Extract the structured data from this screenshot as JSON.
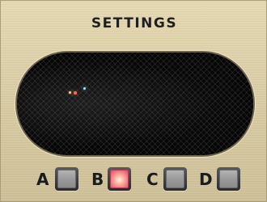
{
  "panel": {
    "title": "SETTINGS"
  },
  "buttons": [
    {
      "label": "A",
      "active": false
    },
    {
      "label": "B",
      "active": true
    },
    {
      "label": "C",
      "active": false
    },
    {
      "label": "D",
      "active": false
    }
  ],
  "colors": {
    "panel_bg": "#d8cba3",
    "grille": "#080808",
    "active_button": "#ee6e7c",
    "inactive_button": "#9a9a9a"
  }
}
